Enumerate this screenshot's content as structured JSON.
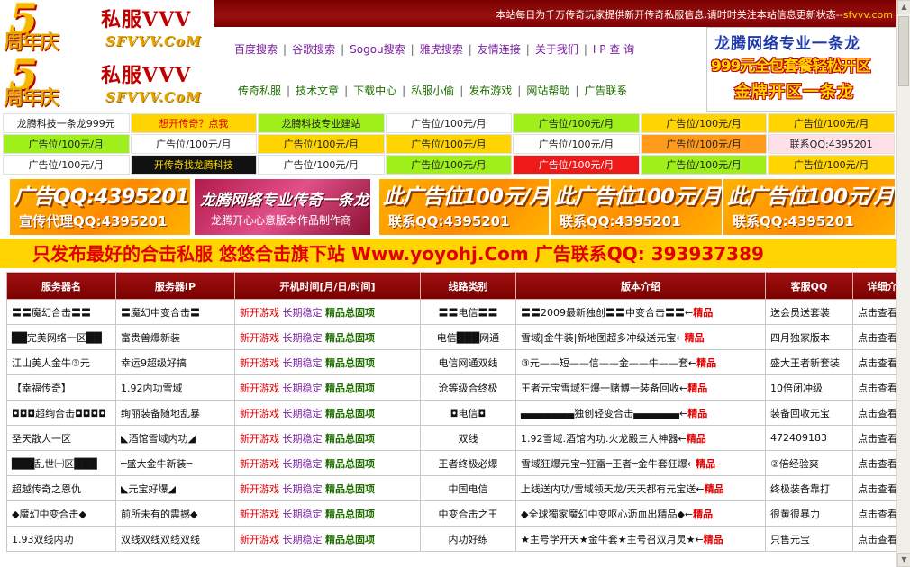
{
  "logos": [
    {
      "year_digit": "5",
      "anniv": "周年庆",
      "name": "私服VVV",
      "domain": "SFVVV.CoM"
    },
    {
      "year_digit": "5",
      "anniv": "周年庆",
      "name": "私服VVV",
      "domain": "SFVVV.CoM"
    }
  ],
  "header": {
    "ticker": "本站每日为千万传奇玩家提供新开传奇私服信息,请时时关注本站信息更新状态--",
    "ticker_domain": "sfvvv.com"
  },
  "nav": {
    "row1": [
      "百度搜索",
      "谷歌搜索",
      "Sogou搜索",
      "雅虎搜索",
      "友情连接",
      "关于我们",
      "I P 查 询"
    ],
    "row2": [
      "传奇私服",
      "技术文章",
      "下载中心",
      "私服小偷",
      "发布游戏",
      "网站帮助",
      "广告联系"
    ]
  },
  "top_right_ad": {
    "line1": "龙腾网络专业一条龙",
    "line2": "999元全包套餐轻松开区",
    "line3": "金牌开区一条龙"
  },
  "ad_grid": [
    [
      {
        "text": "龙腾科技一条龙999元",
        "bg": "#ffffff",
        "fg": "#222222"
      },
      {
        "text": "想开传奇？点我",
        "bg": "#ffd400",
        "fg": "#e00000"
      },
      {
        "text": "龙腾科技专业建站",
        "bg": "#9ff01a",
        "fg": "#222222"
      },
      {
        "text": "广告位/100元/月",
        "bg": "#ffffff",
        "fg": "#222222"
      },
      {
        "text": "广告位/100元/月",
        "bg": "#9ff01a",
        "fg": "#222222"
      },
      {
        "text": "广告位/100元/月",
        "bg": "#ffd400",
        "fg": "#222222"
      },
      {
        "text": "广告位/100元/月",
        "bg": "#ffd400",
        "fg": "#222222"
      }
    ],
    [
      {
        "text": "广告位/100元/月",
        "bg": "#9ff01a",
        "fg": "#222222"
      },
      {
        "text": "广告位/100元/月",
        "bg": "#ffffff",
        "fg": "#222222"
      },
      {
        "text": "广告位/100元/月",
        "bg": "#ffd400",
        "fg": "#222222"
      },
      {
        "text": "广告位/100元/月",
        "bg": "#ffd400",
        "fg": "#222222"
      },
      {
        "text": "广告位/100元/月",
        "bg": "#ffffff",
        "fg": "#222222"
      },
      {
        "text": "广告位/100元/月",
        "bg": "#ff9a1a",
        "fg": "#222222"
      },
      {
        "text": "联系QQ:4395201",
        "bg": "#ffe0e8",
        "fg": "#222222"
      }
    ],
    [
      {
        "text": "广告位/100元/月",
        "bg": "#ffffff",
        "fg": "#222222"
      },
      {
        "text": "开传奇找龙腾科技",
        "bg": "#111111",
        "fg": "#ffd400"
      },
      {
        "text": "广告位/100元/月",
        "bg": "#ffffff",
        "fg": "#222222"
      },
      {
        "text": "广告位/100元/月",
        "bg": "#9ff01a",
        "fg": "#222222"
      },
      {
        "text": "广告位/100元/月",
        "bg": "#ee1a1a",
        "fg": "#ffffff"
      },
      {
        "text": "广告位/100元/月",
        "bg": "#9ff01a",
        "fg": "#222222"
      },
      {
        "text": "广告位/100元/月",
        "bg": "#ffd400",
        "fg": "#222222"
      }
    ]
  ],
  "banners": [
    {
      "type": "gold",
      "t1": "广告QQ:4395201",
      "t2": "宣传代理QQ:4395201"
    },
    {
      "type": "pink",
      "t1": "龙腾网络专业传奇一条龙",
      "t2": "龙腾开心心意版本作品制作商"
    },
    {
      "type": "gold",
      "t1": "此广告位100元/月",
      "t2": "联系QQ:4395201"
    },
    {
      "type": "gold",
      "t1": "此广告位100元/月",
      "t2": "联系QQ:4395201"
    },
    {
      "type": "gold",
      "t1": "此广告位100元/月",
      "t2": "联系QQ:4395201"
    }
  ],
  "yellow_bar": "只发布最好的合击私服  悠悠合击旗下站  Www.yoyohj.Com 广告联系QQ: 393937389",
  "table": {
    "headers": [
      "服务器名",
      "服务器IP",
      "开机时间[月/日/时间]",
      "线路类别",
      "版本介绍",
      "客服QQ",
      "详细介绍"
    ],
    "status": {
      "a": "新开游戏",
      "b": "长期稳定",
      "c": "精品",
      "d": "总",
      "e": "固",
      "f": "项"
    },
    "rows": [
      {
        "name": "〓〓魔幻合击〓〓",
        "ip": "〓魔幻中变合击〓",
        "line": "〓〓电信〓〓",
        "ver": "〓〓2009最新独创〓〓中变合击〓〓←",
        "hot": "精品",
        "qq": "送会员送套装",
        "detail": "点击查看"
      },
      {
        "name": "██完美网络一区██",
        "ip": "富贵兽爆新装",
        "line": "电信███网通",
        "ver": "雪域|金牛装|新地图超多冲级送元宝←",
        "hot": "精品",
        "qq": "四月独家版本",
        "detail": "点击查看"
      },
      {
        "name": "江山美人金牛③元",
        "ip": "幸运9超级好搞",
        "line": "电信网通双线",
        "ver": "③元——短——信——金——牛——套←",
        "hot": "精品",
        "qq": "盛大王者新套装",
        "detail": "点击查看"
      },
      {
        "name": "【幸福传奇】",
        "ip": "1.92内功雪域",
        "line": "沧等级合终极",
        "ver": "王者元宝雪域狂爆一赌博一装备回收←",
        "hot": "精品",
        "qq": "10倍闭冲级",
        "detail": "点击查看"
      },
      {
        "name": "◘◘◘超绚合击◘◘◘◘",
        "ip": "绚丽装备随地乱暴",
        "line": "◘电信◘",
        "ver": "▄▄▄▄▄▄▄独创轻变合击▄▄▄▄▄▄←",
        "hot": "精品",
        "qq": "装备回收元宝",
        "detail": "点击查看"
      },
      {
        "name": "圣天散人一区",
        "ip": "◣酒馆雪域内功◢",
        "line": "双线",
        "ver": "1.92雪域.酒馆内功.火龙殿三大神器←",
        "hot": "精品",
        "qq": "472409183",
        "detail": "点击查看"
      },
      {
        "name": "███乱世㈠区███",
        "ip": "━盛大金牛新装━",
        "line": "王者终极必爆",
        "ver": "雪域狂爆元宝━狂雷━王者━金牛套狂爆←",
        "hot": "精品",
        "qq": "②倍经验爽",
        "detail": "点击查看"
      },
      {
        "name": "超越传奇之恩仇",
        "ip": "◣元宝好爆◢",
        "line": "中国电信",
        "ver": "上线送内功/雪域领天龙/天天都有元宝送←",
        "hot": "精品",
        "qq": "终极装备靠打",
        "detail": "点击查看"
      },
      {
        "name": "◆魔幻中变合击◆",
        "ip": "前所未有的震撼◆",
        "line": "中变合击之王",
        "ver": "◆全球獨家魔幻中变呕心沥血出精品◆←",
        "hot": "精品",
        "qq": "很黄很暴力",
        "detail": "点击查看"
      },
      {
        "name": "1.93双线内功",
        "ip": "双线双线双线双线",
        "line": "内功好练",
        "ver": "★主号学开天★金牛套★主号召双月灵★←",
        "hot": "精品",
        "qq": "只售元宝",
        "detail": "点击查看"
      }
    ]
  }
}
